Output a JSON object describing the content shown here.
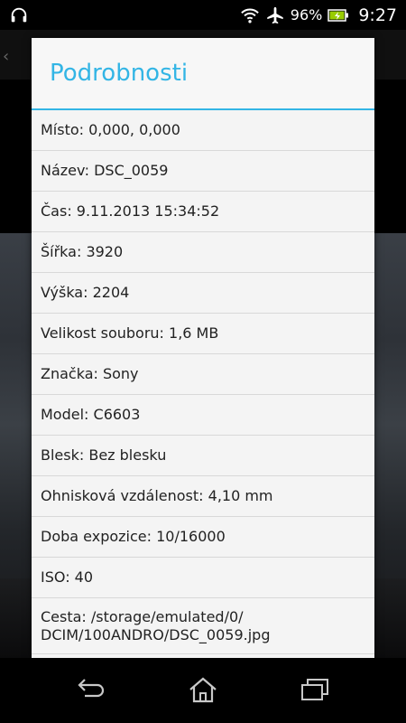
{
  "statusbar": {
    "battery_percent": "96%",
    "time": "9:27",
    "icons": [
      "headphones-icon",
      "wifi-icon",
      "airplane-icon",
      "battery-icon"
    ],
    "battery_color": "#99cc00"
  },
  "dialog": {
    "title": "Podrobnosti",
    "accent_color": "#33b5e5",
    "rows": [
      "Místo: 0,000, 0,000",
      "Název: DSC_0059",
      "Čas: 9.11.2013 15:34:52",
      "Šířka: 3920",
      "Výška: 2204",
      "Velikost souboru: 1,6 MB",
      "Značka: Sony",
      "Model: C6603",
      "Blesk: Bez blesku",
      "Ohnisková vzdálenost: 4,10 mm",
      "Doba expozice: 10/16000",
      "ISO: 40",
      "Cesta: /storage/emulated/0/\nDCIM/100ANDRO/DSC_0059.jpg"
    ]
  },
  "navbar": {
    "icons": [
      "back-icon",
      "home-icon",
      "recent-apps-icon"
    ]
  }
}
